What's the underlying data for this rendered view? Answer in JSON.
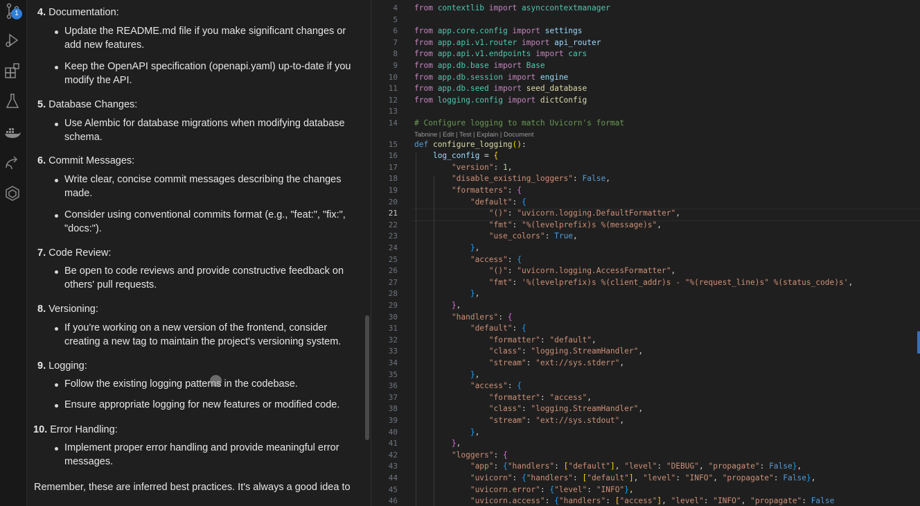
{
  "activity_bar": {
    "items": [
      {
        "name": "source-control-icon",
        "badge": "1"
      },
      {
        "name": "run-debug-icon"
      },
      {
        "name": "extensions-icon"
      },
      {
        "name": "testing-icon"
      },
      {
        "name": "docker-icon"
      },
      {
        "name": "remote-explorer-icon"
      },
      {
        "name": "ai-assistant-icon"
      }
    ]
  },
  "chat": {
    "sections": [
      {
        "number": "4.",
        "title": "Documentation:",
        "bullets": [
          "Update the README.md file if you make significant changes or add new features.",
          "Keep the OpenAPI specification (openapi.yaml) up-to-date if you modify the API."
        ]
      },
      {
        "number": "5.",
        "title": "Database Changes:",
        "bullets": [
          "Use Alembic for database migrations when modifying database schema."
        ]
      },
      {
        "number": "6.",
        "title": "Commit Messages:",
        "bullets": [
          "Write clear, concise commit messages describing the changes made.",
          "Consider using conventional commits format (e.g., \"feat:\", \"fix:\", \"docs:\")."
        ]
      },
      {
        "number": "7.",
        "title": "Code Review:",
        "bullets": [
          "Be open to code reviews and provide constructive feedback on others' pull requests."
        ]
      },
      {
        "number": "8.",
        "title": "Versioning:",
        "bullets": [
          "If you're working on a new version of the frontend, consider creating a new tag to maintain the project's versioning system."
        ]
      },
      {
        "number": "9.",
        "title": "Logging:",
        "bullets": [
          "Follow the existing logging patterns in the codebase.",
          "Ensure appropriate logging for new features or modified code."
        ]
      },
      {
        "number": "10.",
        "title": "Error Handling:",
        "bullets": [
          "Implement proper error handling and provide meaningful error messages."
        ]
      }
    ],
    "closing_text": "Remember, these are inferred best practices. It's always a good idea to"
  },
  "editor": {
    "active_line": "21",
    "code_lens": "Tabnine | Edit | Test | Explain | Document",
    "line_numbers": [
      "4",
      "5",
      "6",
      "7",
      "8",
      "9",
      "10",
      "11",
      "12",
      "13",
      "14",
      "15",
      "16",
      "17",
      "18",
      "19",
      "20",
      "21",
      "22",
      "23",
      "24",
      "25",
      "26",
      "27",
      "28",
      "29",
      "30",
      "31",
      "32",
      "33",
      "34",
      "35",
      "36",
      "37",
      "38",
      "39",
      "40",
      "41",
      "42",
      "43",
      "44",
      "45",
      "46"
    ],
    "lines": [
      [
        [
          "kw",
          "from "
        ],
        [
          "ident",
          "contextlib"
        ],
        [
          "kw",
          " import "
        ],
        [
          "ident",
          "asynccontextmanager"
        ]
      ],
      [],
      [
        [
          "kw",
          "from "
        ],
        [
          "ident",
          "app.core.config"
        ],
        [
          "kw",
          " import "
        ],
        [
          "var",
          "settings"
        ]
      ],
      [
        [
          "kw",
          "from "
        ],
        [
          "ident",
          "app.api.v1.router"
        ],
        [
          "kw",
          " import "
        ],
        [
          "var",
          "api_router"
        ]
      ],
      [
        [
          "kw",
          "from "
        ],
        [
          "ident",
          "app.api.v1.endpoints"
        ],
        [
          "kw",
          " import "
        ],
        [
          "ident",
          "cars"
        ]
      ],
      [
        [
          "kw",
          "from "
        ],
        [
          "ident",
          "app.db.base"
        ],
        [
          "kw",
          " import "
        ],
        [
          "ident",
          "Base"
        ]
      ],
      [
        [
          "kw",
          "from "
        ],
        [
          "ident",
          "app.db.session"
        ],
        [
          "kw",
          " import "
        ],
        [
          "var",
          "engine"
        ]
      ],
      [
        [
          "kw",
          "from "
        ],
        [
          "ident",
          "app.db.seed"
        ],
        [
          "kw",
          " import "
        ],
        [
          "fn",
          "seed_database"
        ]
      ],
      [
        [
          "kw",
          "from "
        ],
        [
          "ident",
          "logging.config"
        ],
        [
          "kw",
          " import "
        ],
        [
          "fn",
          "dictConfig"
        ]
      ],
      [],
      [
        [
          "cmt",
          "# Configure logging to match Uvicorn's format"
        ]
      ],
      [
        [
          "cst",
          "def "
        ],
        [
          "fn",
          "configure_logging"
        ],
        [
          "p1",
          "()"
        ],
        [
          "txt",
          ":"
        ]
      ],
      [
        [
          "txt",
          "    "
        ],
        [
          "var",
          "log_config"
        ],
        [
          "txt",
          " = "
        ],
        [
          "p1",
          "{"
        ]
      ],
      [
        [
          "txt",
          "        "
        ],
        [
          "str",
          "\"version\""
        ],
        [
          "txt",
          ": "
        ],
        [
          "numc",
          "1"
        ],
        [
          "txt",
          ","
        ]
      ],
      [
        [
          "txt",
          "        "
        ],
        [
          "str",
          "\"disable_existing_loggers\""
        ],
        [
          "txt",
          ": "
        ],
        [
          "cst",
          "False"
        ],
        [
          "txt",
          ","
        ]
      ],
      [
        [
          "txt",
          "        "
        ],
        [
          "str",
          "\"formatters\""
        ],
        [
          "txt",
          ": "
        ],
        [
          "p2",
          "{"
        ]
      ],
      [
        [
          "txt",
          "            "
        ],
        [
          "str",
          "\"default\""
        ],
        [
          "txt",
          ": "
        ],
        [
          "p3",
          "{"
        ]
      ],
      [
        [
          "txt",
          "                "
        ],
        [
          "str",
          "\"()\""
        ],
        [
          "txt",
          ": "
        ],
        [
          "str",
          "\"uvicorn.logging.DefaultFormatter\""
        ],
        [
          "txt",
          ","
        ]
      ],
      [
        [
          "txt",
          "                "
        ],
        [
          "str",
          "\"fmt\""
        ],
        [
          "txt",
          ": "
        ],
        [
          "str",
          "\"%(levelprefix)s %(message)s\""
        ],
        [
          "txt",
          ","
        ]
      ],
      [
        [
          "txt",
          "                "
        ],
        [
          "str",
          "\"use_colors\""
        ],
        [
          "txt",
          ": "
        ],
        [
          "cst",
          "True"
        ],
        [
          "txt",
          ","
        ]
      ],
      [
        [
          "txt",
          "            "
        ],
        [
          "p3",
          "}"
        ],
        [
          "txt",
          ","
        ]
      ],
      [
        [
          "txt",
          "            "
        ],
        [
          "str",
          "\"access\""
        ],
        [
          "txt",
          ": "
        ],
        [
          "p3",
          "{"
        ]
      ],
      [
        [
          "txt",
          "                "
        ],
        [
          "str",
          "\"()\""
        ],
        [
          "txt",
          ": "
        ],
        [
          "str",
          "\"uvicorn.logging.AccessFormatter\""
        ],
        [
          "txt",
          ","
        ]
      ],
      [
        [
          "txt",
          "                "
        ],
        [
          "str",
          "\"fmt\""
        ],
        [
          "txt",
          ": "
        ],
        [
          "str",
          "'%(levelprefix)s %(client_addr)s - \"%(request_line)s\" %(status_code)s'"
        ],
        [
          "txt",
          ","
        ]
      ],
      [
        [
          "txt",
          "            "
        ],
        [
          "p3",
          "}"
        ],
        [
          "txt",
          ","
        ]
      ],
      [
        [
          "txt",
          "        "
        ],
        [
          "p2",
          "}"
        ],
        [
          "txt",
          ","
        ]
      ],
      [
        [
          "txt",
          "        "
        ],
        [
          "str",
          "\"handlers\""
        ],
        [
          "txt",
          ": "
        ],
        [
          "p2",
          "{"
        ]
      ],
      [
        [
          "txt",
          "            "
        ],
        [
          "str",
          "\"default\""
        ],
        [
          "txt",
          ": "
        ],
        [
          "p3",
          "{"
        ]
      ],
      [
        [
          "txt",
          "                "
        ],
        [
          "str",
          "\"formatter\""
        ],
        [
          "txt",
          ": "
        ],
        [
          "str",
          "\"default\""
        ],
        [
          "txt",
          ","
        ]
      ],
      [
        [
          "txt",
          "                "
        ],
        [
          "str",
          "\"class\""
        ],
        [
          "txt",
          ": "
        ],
        [
          "str",
          "\"logging.StreamHandler\""
        ],
        [
          "txt",
          ","
        ]
      ],
      [
        [
          "txt",
          "                "
        ],
        [
          "str",
          "\"stream\""
        ],
        [
          "txt",
          ": "
        ],
        [
          "str",
          "\"ext://sys.stderr\""
        ],
        [
          "txt",
          ","
        ]
      ],
      [
        [
          "txt",
          "            "
        ],
        [
          "p3",
          "}"
        ],
        [
          "txt",
          ","
        ]
      ],
      [
        [
          "txt",
          "            "
        ],
        [
          "str",
          "\"access\""
        ],
        [
          "txt",
          ": "
        ],
        [
          "p3",
          "{"
        ]
      ],
      [
        [
          "txt",
          "                "
        ],
        [
          "str",
          "\"formatter\""
        ],
        [
          "txt",
          ": "
        ],
        [
          "str",
          "\"access\""
        ],
        [
          "txt",
          ","
        ]
      ],
      [
        [
          "txt",
          "                "
        ],
        [
          "str",
          "\"class\""
        ],
        [
          "txt",
          ": "
        ],
        [
          "str",
          "\"logging.StreamHandler\""
        ],
        [
          "txt",
          ","
        ]
      ],
      [
        [
          "txt",
          "                "
        ],
        [
          "str",
          "\"stream\""
        ],
        [
          "txt",
          ": "
        ],
        [
          "str",
          "\"ext://sys.stdout\""
        ],
        [
          "txt",
          ","
        ]
      ],
      [
        [
          "txt",
          "            "
        ],
        [
          "p3",
          "}"
        ],
        [
          "txt",
          ","
        ]
      ],
      [
        [
          "txt",
          "        "
        ],
        [
          "p2",
          "}"
        ],
        [
          "txt",
          ","
        ]
      ],
      [
        [
          "txt",
          "        "
        ],
        [
          "str",
          "\"loggers\""
        ],
        [
          "txt",
          ": "
        ],
        [
          "p2",
          "{"
        ]
      ],
      [
        [
          "txt",
          "            "
        ],
        [
          "str",
          "\"app\""
        ],
        [
          "txt",
          ": "
        ],
        [
          "p3",
          "{"
        ],
        [
          "str",
          "\"handlers\""
        ],
        [
          "txt",
          ": "
        ],
        [
          "p1",
          "["
        ],
        [
          "str",
          "\"default\""
        ],
        [
          "p1",
          "]"
        ],
        [
          "txt",
          ", "
        ],
        [
          "str",
          "\"level\""
        ],
        [
          "txt",
          ": "
        ],
        [
          "str",
          "\"DEBUG\""
        ],
        [
          "txt",
          ", "
        ],
        [
          "str",
          "\"propagate\""
        ],
        [
          "txt",
          ": "
        ],
        [
          "cst",
          "False"
        ],
        [
          "p3",
          "}"
        ],
        [
          "txt",
          ","
        ]
      ],
      [
        [
          "txt",
          "            "
        ],
        [
          "str",
          "\"uvicorn\""
        ],
        [
          "txt",
          ": "
        ],
        [
          "p3",
          "{"
        ],
        [
          "str",
          "\"handlers\""
        ],
        [
          "txt",
          ": "
        ],
        [
          "p1",
          "["
        ],
        [
          "str",
          "\"default\""
        ],
        [
          "p1",
          "]"
        ],
        [
          "txt",
          ", "
        ],
        [
          "str",
          "\"level\""
        ],
        [
          "txt",
          ": "
        ],
        [
          "str",
          "\"INFO\""
        ],
        [
          "txt",
          ", "
        ],
        [
          "str",
          "\"propagate\""
        ],
        [
          "txt",
          ": "
        ],
        [
          "cst",
          "False"
        ],
        [
          "p3",
          "}"
        ],
        [
          "txt",
          ","
        ]
      ],
      [
        [
          "txt",
          "            "
        ],
        [
          "str",
          "\"uvicorn.error\""
        ],
        [
          "txt",
          ": "
        ],
        [
          "p3",
          "{"
        ],
        [
          "str",
          "\"level\""
        ],
        [
          "txt",
          ": "
        ],
        [
          "str",
          "\"INFO\""
        ],
        [
          "p3",
          "}"
        ],
        [
          "txt",
          ","
        ]
      ],
      [
        [
          "txt",
          "            "
        ],
        [
          "str",
          "\"uvicorn.access\""
        ],
        [
          "txt",
          ": "
        ],
        [
          "p3",
          "{"
        ],
        [
          "str",
          "\"handlers\""
        ],
        [
          "txt",
          ": "
        ],
        [
          "p1",
          "["
        ],
        [
          "str",
          "\"access\""
        ],
        [
          "p1",
          "]"
        ],
        [
          "txt",
          ", "
        ],
        [
          "str",
          "\"level\""
        ],
        [
          "txt",
          ": "
        ],
        [
          "str",
          "\"INFO\""
        ],
        [
          "txt",
          ", "
        ],
        [
          "str",
          "\"propagate\""
        ],
        [
          "txt",
          ": "
        ],
        [
          "cst",
          "False"
        ]
      ]
    ]
  }
}
